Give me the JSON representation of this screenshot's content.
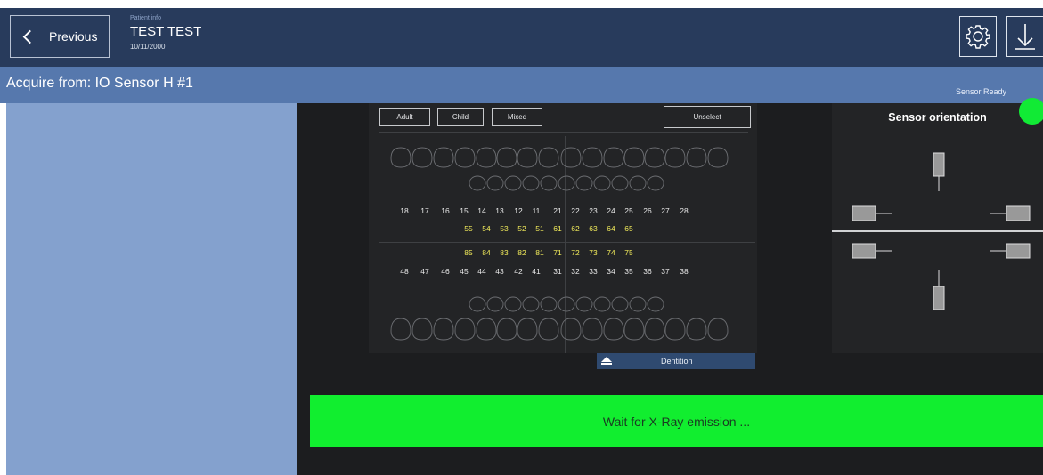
{
  "header": {
    "previous_label": "Previous",
    "patient_label": "Patient info",
    "patient_name": "TEST TEST",
    "patient_date": "10/11/2000",
    "settings_icon": "gear-icon",
    "download_icon": "download-arrow-icon"
  },
  "acquire": {
    "title": "Acquire from: IO Sensor H #1",
    "sensor_status": "Sensor Ready",
    "status_color": "#11ea35"
  },
  "dentition_modes": {
    "adult": "Adult",
    "child": "Child",
    "mixed": "Mixed",
    "unselect": "Unselect"
  },
  "teeth": {
    "upper_permanent": [
      "18",
      "17",
      "16",
      "15",
      "14",
      "13",
      "12",
      "11",
      "21",
      "22",
      "23",
      "24",
      "25",
      "26",
      "27",
      "28"
    ],
    "upper_primary": [
      "55",
      "54",
      "53",
      "52",
      "51",
      "61",
      "62",
      "63",
      "64",
      "65"
    ],
    "lower_primary": [
      "85",
      "84",
      "83",
      "82",
      "81",
      "71",
      "72",
      "73",
      "74",
      "75"
    ],
    "lower_permanent": [
      "48",
      "47",
      "46",
      "45",
      "44",
      "43",
      "42",
      "41",
      "31",
      "32",
      "33",
      "34",
      "35",
      "36",
      "37",
      "38"
    ]
  },
  "dentition": {
    "label": "Dentition"
  },
  "orientation": {
    "title": "Sensor orientation"
  },
  "status_message": "Wait for X-Ray emission ...",
  "colors": {
    "topbar": "#283b5c",
    "acquire_bar": "#5678ad",
    "left_panel": "#84a1ce",
    "wait_bar": "#11ee2f",
    "primary_teeth": "#f1ea5a"
  }
}
